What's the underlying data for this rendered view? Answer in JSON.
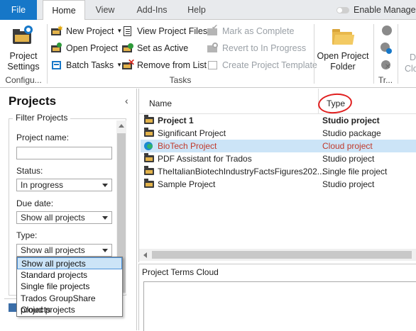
{
  "tabs": {
    "file": "File",
    "home": "Home",
    "view": "View",
    "addins": "Add-Ins",
    "help": "Help",
    "enable_manager": "Enable Manager"
  },
  "ribbon": {
    "project_settings": [
      "Project",
      "Settings"
    ],
    "configure_label": "Configu...",
    "new_project": "New Project",
    "open_project": "Open Project",
    "batch_tasks": "Batch Tasks",
    "view_project_files": "View Project Files",
    "set_as_active": "Set as Active",
    "remove_from_list": "Remove from List",
    "mark_as_complete": "Mark as Complete",
    "revert_to_in_progress": "Revert to In Progress",
    "create_project_template": "Create Project Template",
    "tasks_label": "Tasks",
    "open_project_folder": [
      "Open Project",
      "Folder"
    ],
    "tr_label": "Tr...",
    "cut_d": "D",
    "cut_clo": "Clo"
  },
  "left": {
    "title": "Projects",
    "filter_title": "Filter Projects",
    "project_name_label": "Project name:",
    "project_name_value": "",
    "status_label": "Status:",
    "status_value": "In progress",
    "due_date_label": "Due date:",
    "due_date_value": "Show all projects",
    "type_label": "Type:",
    "type_value": "Show all projects",
    "type_options": [
      "Show all projects",
      "Standard projects",
      "Single file projects",
      "Trados GroupShare projects",
      "Cloud projects"
    ]
  },
  "list": {
    "col_name": "Name",
    "col_type": "Type",
    "rows": [
      {
        "name": "Project 1",
        "type": "Studio project",
        "bold": true
      },
      {
        "name": "Significant Project",
        "type": "Studio package"
      },
      {
        "name": "BioTech Project",
        "type": "Cloud project",
        "selected": true
      },
      {
        "name": "PDF Assistant for Trados",
        "type": "Studio project"
      },
      {
        "name": "TheItalianBiotechIndustryFactsFigures202...",
        "type": "Single file project"
      },
      {
        "name": "Sample Project",
        "type": "Studio project"
      }
    ]
  },
  "terms_cloud": {
    "title": "Project Terms Cloud"
  },
  "colors": {
    "accent": "#1677c8",
    "cloud_text": "#c0392b",
    "selected_row": "#cce4f7",
    "annotation": "#e02020"
  }
}
